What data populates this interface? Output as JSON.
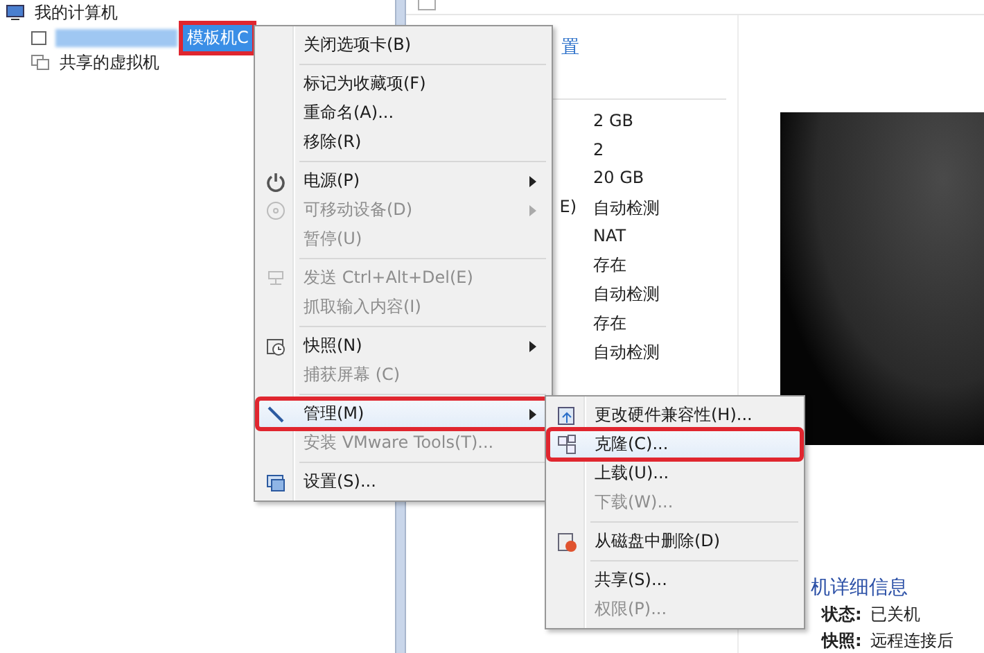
{
  "tree": {
    "items": [
      {
        "label": "我的计算机",
        "kind": "computer",
        "selected": false,
        "marked": false
      },
      {
        "label": "模板机C",
        "kind": "vm",
        "selected": true,
        "marked": true
      },
      {
        "label": "共享的虚拟机",
        "kind": "shared",
        "selected": false,
        "marked": false
      }
    ]
  },
  "details": {
    "link": "置",
    "label_fragment": "E)",
    "values": [
      "2 GB",
      "2",
      "20 GB",
      "自动检测",
      "NAT",
      "存在",
      "自动检测",
      "存在",
      "自动检测"
    ]
  },
  "vm_info": {
    "title": "机详细信息",
    "rows": [
      {
        "label": "状态:",
        "value": "已关机"
      },
      {
        "label": "快照:",
        "value": "远程连接后"
      }
    ]
  },
  "context_menu": {
    "items": [
      {
        "kind": "item",
        "label": "关闭选项卡(B)",
        "disabled": false,
        "submenu": false,
        "selected": false,
        "marked": false
      },
      {
        "kind": "separator"
      },
      {
        "kind": "item",
        "label": "标记为收藏项(F)",
        "disabled": false,
        "submenu": false,
        "selected": false,
        "marked": false
      },
      {
        "kind": "item",
        "label": "重命名(A)...",
        "disabled": false,
        "submenu": false,
        "selected": false,
        "marked": false
      },
      {
        "kind": "item",
        "label": "移除(R)",
        "disabled": false,
        "submenu": false,
        "selected": false,
        "marked": false
      },
      {
        "kind": "separator"
      },
      {
        "kind": "item",
        "label": "电源(P)",
        "disabled": false,
        "submenu": true,
        "selected": false,
        "marked": false
      },
      {
        "kind": "item",
        "label": "可移动设备(D)",
        "disabled": true,
        "submenu": true,
        "selected": false,
        "marked": false
      },
      {
        "kind": "item",
        "label": "暂停(U)",
        "disabled": true,
        "submenu": false,
        "selected": false,
        "marked": false
      },
      {
        "kind": "separator"
      },
      {
        "kind": "item",
        "label": "发送 Ctrl+Alt+Del(E)",
        "disabled": true,
        "submenu": false,
        "selected": false,
        "marked": false
      },
      {
        "kind": "item",
        "label": "抓取输入内容(I)",
        "disabled": true,
        "submenu": false,
        "selected": false,
        "marked": false
      },
      {
        "kind": "separator"
      },
      {
        "kind": "item",
        "label": "快照(N)",
        "disabled": false,
        "submenu": true,
        "selected": false,
        "marked": false
      },
      {
        "kind": "item",
        "label": "捕获屏幕 (C)",
        "disabled": true,
        "submenu": false,
        "selected": false,
        "marked": false
      },
      {
        "kind": "separator"
      },
      {
        "kind": "item",
        "label": "管理(M)",
        "disabled": false,
        "submenu": true,
        "selected": true,
        "marked": true
      },
      {
        "kind": "item",
        "label": "安装 VMware Tools(T)...",
        "disabled": true,
        "submenu": false,
        "selected": false,
        "marked": false
      },
      {
        "kind": "separator"
      },
      {
        "kind": "item",
        "label": "设置(S)...",
        "disabled": false,
        "submenu": false,
        "selected": false,
        "marked": false
      }
    ]
  },
  "submenu": {
    "items": [
      {
        "kind": "item",
        "label": "更改硬件兼容性(H)...",
        "disabled": false,
        "selected": false,
        "marked": false
      },
      {
        "kind": "item",
        "label": "克隆(C)...",
        "disabled": false,
        "selected": true,
        "marked": true
      },
      {
        "kind": "item",
        "label": "上载(U)...",
        "disabled": false,
        "selected": false,
        "marked": false
      },
      {
        "kind": "item",
        "label": "下载(W)...",
        "disabled": true,
        "selected": false,
        "marked": false
      },
      {
        "kind": "separator"
      },
      {
        "kind": "item",
        "label": "从磁盘中删除(D)",
        "disabled": false,
        "selected": false,
        "marked": false
      },
      {
        "kind": "separator"
      },
      {
        "kind": "item",
        "label": "共享(S)...",
        "disabled": false,
        "selected": false,
        "marked": false
      },
      {
        "kind": "item",
        "label": "权限(P)...",
        "disabled": true,
        "selected": false,
        "marked": false
      }
    ]
  }
}
